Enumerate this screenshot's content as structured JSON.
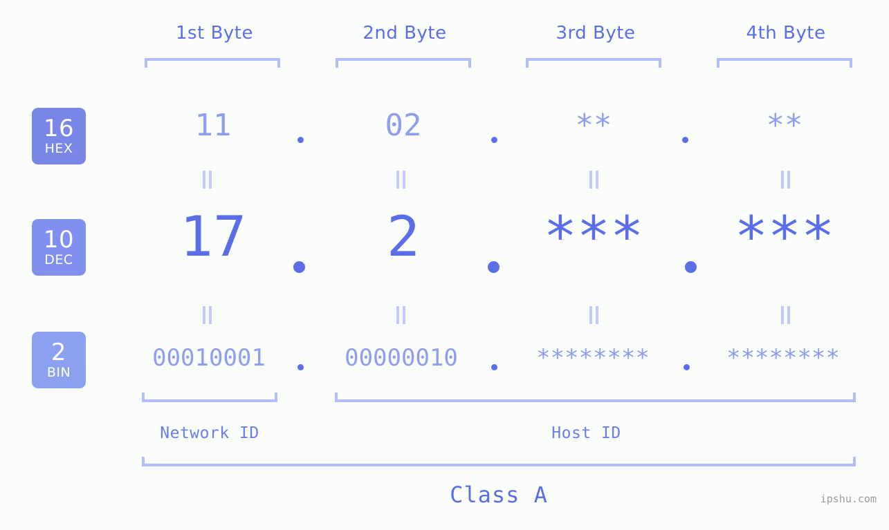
{
  "background_color": "#fbfdfa",
  "accent_color": "#5b6ee8",
  "muted_color": "#909cf0",
  "bracket_color": "#b3bdfb",
  "byte_headers": [
    {
      "label": "1st Byte"
    },
    {
      "label": "2nd Byte"
    },
    {
      "label": "3rd Byte"
    },
    {
      "label": "4th Byte"
    }
  ],
  "bases": [
    {
      "number": "16",
      "name": "HEX",
      "color": "#7986e8"
    },
    {
      "number": "10",
      "name": "DEC",
      "color": "#8190ee"
    },
    {
      "number": "2",
      "name": "BIN",
      "color": "#8ba1f0"
    }
  ],
  "rows": {
    "hex": {
      "values": [
        "11",
        "02",
        "**",
        "**"
      ]
    },
    "dec": {
      "values": [
        "17",
        "2",
        "***",
        "***"
      ]
    },
    "bin": {
      "values": [
        "00010001",
        "00000010",
        "********",
        "********"
      ]
    }
  },
  "separator": ".",
  "equality_mark": "=",
  "sections": [
    {
      "label": "Network ID"
    },
    {
      "label": "Host ID"
    }
  ],
  "class": {
    "label": "Class A"
  },
  "watermark": {
    "text": "ipshu.com"
  }
}
